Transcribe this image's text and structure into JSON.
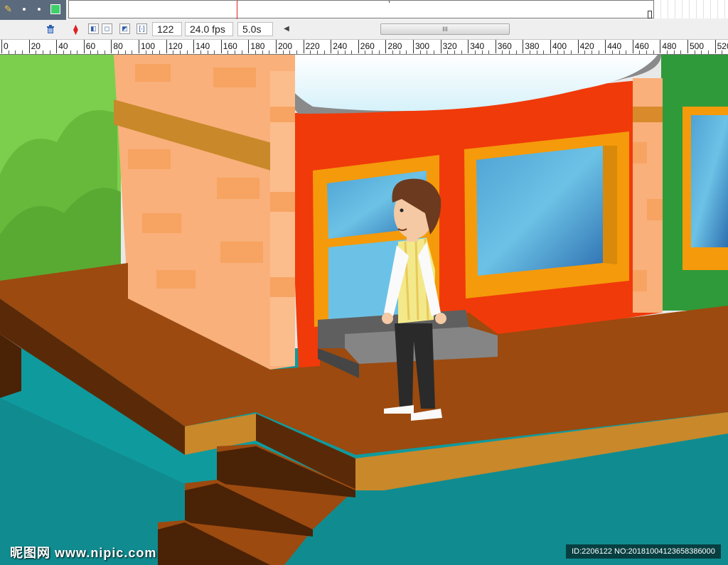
{
  "timeline": {
    "frame_number": "122",
    "frame_rate": "24.0 fps",
    "elapsed_time": "5.0s",
    "scroll_thumb_grip": "III"
  },
  "ruler": {
    "labels": [
      "0",
      "20",
      "40",
      "60",
      "80",
      "100",
      "120",
      "140",
      "160",
      "180",
      "200",
      "220",
      "240",
      "260",
      "280",
      "300",
      "320",
      "340",
      "360",
      "380",
      "400",
      "420",
      "440",
      "460",
      "480",
      "500",
      "520"
    ]
  },
  "watermark": {
    "site": "昵图网 www.nipic.com",
    "id_text": "ID:2206122 NO:20181004123658386000"
  },
  "colors": {
    "sky_green": "#7bc94a",
    "wall_red": "#f03a0a",
    "brick": "#f9b07a",
    "deck": "#9c4a0f",
    "water": "#0f9a9e",
    "window_frame": "#f59a0a",
    "glass": "#5cb6d9"
  }
}
